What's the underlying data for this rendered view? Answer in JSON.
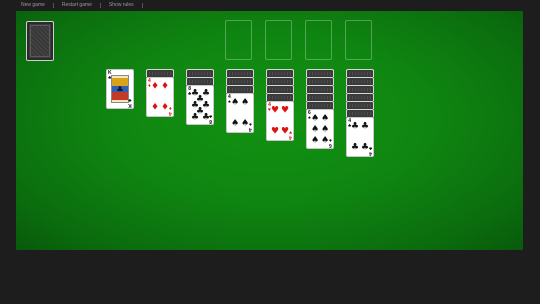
{
  "menu": {
    "new_game": "New game",
    "restart_game": "Restart game",
    "show_rules": "Show rules"
  },
  "colors": {
    "felt": "#0f8511",
    "background": "#1d1d1d",
    "red_suit": "#dd1111",
    "black_suit": "#111111"
  },
  "stock": {
    "icon": "card-back"
  },
  "foundations": [
    "empty",
    "empty",
    "empty",
    "empty"
  ],
  "tableau": [
    {
      "hidden": 0,
      "face": {
        "rank": "K",
        "suit": "♣",
        "color": "black"
      }
    },
    {
      "hidden": 1,
      "face": {
        "rank": "4",
        "suit": "♦",
        "color": "red"
      }
    },
    {
      "hidden": 2,
      "face": {
        "rank": "8",
        "suit": "♣",
        "color": "black"
      }
    },
    {
      "hidden": 3,
      "face": {
        "rank": "4",
        "suit": "♠",
        "color": "black"
      }
    },
    {
      "hidden": 4,
      "face": {
        "rank": "4",
        "suit": "♥",
        "color": "red"
      }
    },
    {
      "hidden": 5,
      "face": {
        "rank": "6",
        "suit": "♠",
        "color": "black"
      }
    },
    {
      "hidden": 6,
      "face": {
        "rank": "4",
        "suit": "♣",
        "color": "black"
      }
    }
  ]
}
